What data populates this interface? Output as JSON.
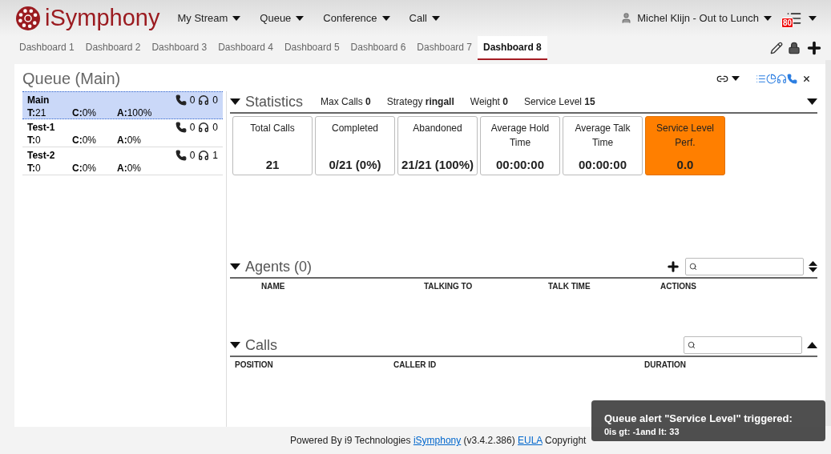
{
  "header": {
    "logo": "iSymphony",
    "menus": [
      {
        "label": "My Stream"
      },
      {
        "label": "Queue"
      },
      {
        "label": "Conference"
      },
      {
        "label": "Call"
      }
    ],
    "user": "Michel Klijn - Out to Lunch",
    "badge": "80"
  },
  "tabs": [
    {
      "label": "Dashboard 1",
      "selected": false
    },
    {
      "label": "Dashboard 2",
      "selected": false
    },
    {
      "label": "Dashboard 3",
      "selected": false
    },
    {
      "label": "Dashboard 4",
      "selected": false
    },
    {
      "label": "Dashboard 5",
      "selected": false
    },
    {
      "label": "Dashboard 6",
      "selected": false
    },
    {
      "label": "Dashboard 7",
      "selected": false
    },
    {
      "label": "Dashboard 8",
      "selected": true
    }
  ],
  "panel": {
    "title": "Queue (Main)",
    "queues": [
      {
        "name": "Main",
        "t": "**T:**21",
        "c": "**C:**0%",
        "a": "**A:**100%",
        "calls": "0",
        "agents": "0",
        "selected": true
      },
      {
        "name": "Test-1",
        "t": "**T:**0",
        "c": "**C:**0%",
        "a": "**A:**0%",
        "calls": "0",
        "agents": "0",
        "selected": false
      },
      {
        "name": "Test-2",
        "t": "**T:**0",
        "c": "**C:**0%",
        "a": "**A:**0%",
        "calls": "0",
        "agents": "1",
        "selected": false
      }
    ],
    "statistics": {
      "title": "Statistics",
      "params": [
        "Max Calls **0**",
        "Strategy **ringall**",
        "Weight **0**",
        "Service Level **15**"
      ],
      "cards": [
        {
          "label": "Total Calls",
          "value": "21",
          "highlighted": false
        },
        {
          "label": "Completed",
          "value": "0/21 (0%)",
          "highlighted": false
        },
        {
          "label": "Abandoned",
          "value": "21/21 (100%)",
          "highlighted": false
        },
        {
          "label": "Average Hold Time",
          "value": "00:00:00",
          "highlighted": false
        },
        {
          "label": "Average Talk Time",
          "value": "00:00:00",
          "highlighted": false
        },
        {
          "label": "Service Level Perf.",
          "value": "0.0",
          "highlighted": true
        }
      ]
    },
    "agents": {
      "title": "Agents (0)",
      "columns": [
        "NAME",
        "TALKING TO",
        "TALK TIME",
        "ACTIONS"
      ]
    },
    "calls": {
      "title": "Calls",
      "columns": [
        "POSITION",
        "CALLER ID",
        "DURATION"
      ]
    }
  },
  "footer": [
    {
      "kind": "text",
      "text": "Powered By i9 Technologies"
    },
    {
      "kind": "link",
      "text": "iSymphony"
    },
    {
      "kind": "text",
      "text": "(v3.4.2.386)"
    },
    {
      "kind": "link",
      "text": "EULA"
    },
    {
      "kind": "text",
      "text": "Copyright"
    }
  ],
  "toast": {
    "title": "Queue alert \"Service Level\" triggered:",
    "message": "0is gt: -1and lt: 33"
  }
}
